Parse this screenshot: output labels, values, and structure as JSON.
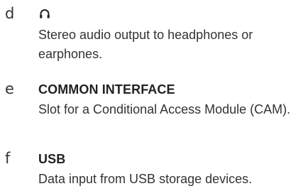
{
  "items": [
    {
      "letter": "d",
      "icon": "headphones-icon",
      "title": "",
      "description": "Stereo audio output to headphones or earphones."
    },
    {
      "letter": "e",
      "title": "COMMON INTERFACE",
      "description": "Slot for a Conditional Access Module (CAM)."
    },
    {
      "letter": "f",
      "title": "USB",
      "description": "Data input from USB storage devices."
    }
  ]
}
